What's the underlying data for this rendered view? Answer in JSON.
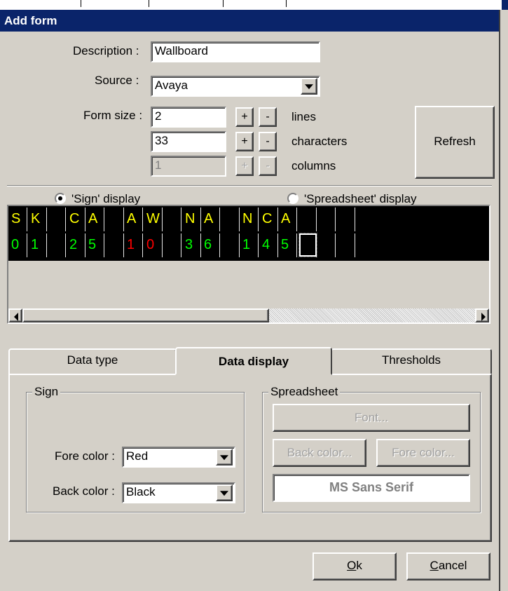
{
  "window": {
    "title": "Add form"
  },
  "form": {
    "description_label": "Description :",
    "description_value": "Wallboard",
    "source_label": "Source :",
    "source_value": "Avaya",
    "formsize_label": "Form size :",
    "lines_value": "2",
    "lines_label": "lines",
    "chars_value": "33",
    "chars_label": "characters",
    "columns_value": "1",
    "columns_label": "columns",
    "plus": "+",
    "minus": "-",
    "refresh": "Refresh"
  },
  "display": {
    "sign_label": "'Sign' display",
    "spreadsheet_label": "'Spreadsheet' display"
  },
  "sign": {
    "row1": [
      {
        "t": "S",
        "c": "#ffff00"
      },
      {
        "t": "K",
        "c": "#ffff00"
      },
      {
        "t": "",
        "c": "#ffff00"
      },
      {
        "t": "C",
        "c": "#ffff00"
      },
      {
        "t": "A",
        "c": "#ffff00"
      },
      {
        "t": "",
        "c": "#ffff00"
      },
      {
        "t": "A",
        "c": "#ffff00"
      },
      {
        "t": "W",
        "c": "#ffff00"
      },
      {
        "t": "",
        "c": "#ffff00"
      },
      {
        "t": "N",
        "c": "#ffff00"
      },
      {
        "t": "A",
        "c": "#ffff00"
      },
      {
        "t": "",
        "c": "#ffff00"
      },
      {
        "t": "N",
        "c": "#ffff00"
      },
      {
        "t": "C",
        "c": "#ffff00"
      },
      {
        "t": "A",
        "c": "#ffff00"
      },
      {
        "t": "",
        "c": "#ffff00"
      },
      {
        "t": "",
        "c": "#ffff00"
      },
      {
        "t": "",
        "c": "#ffff00"
      }
    ],
    "row2": [
      {
        "t": "0",
        "c": "#00ff00"
      },
      {
        "t": "1",
        "c": "#00ff00"
      },
      {
        "t": "",
        "c": "#00ff00"
      },
      {
        "t": "2",
        "c": "#00ff00"
      },
      {
        "t": "5",
        "c": "#00ff00"
      },
      {
        "t": "",
        "c": "#00ff00"
      },
      {
        "t": "1",
        "c": "#ff0000"
      },
      {
        "t": "0",
        "c": "#ff0000"
      },
      {
        "t": "",
        "c": "#00ff00"
      },
      {
        "t": "3",
        "c": "#00ff00"
      },
      {
        "t": "6",
        "c": "#00ff00"
      },
      {
        "t": "",
        "c": "#00ff00"
      },
      {
        "t": "1",
        "c": "#00ff00"
      },
      {
        "t": "4",
        "c": "#00ff00"
      },
      {
        "t": "5",
        "c": "#00ff00"
      },
      {
        "t": "",
        "c": "#00ff00"
      },
      {
        "t": "",
        "c": "#00ff00"
      },
      {
        "t": "",
        "c": "#00ff00"
      }
    ]
  },
  "tabs": {
    "data_type": "Data type",
    "data_display": "Data display",
    "thresholds": "Thresholds"
  },
  "sign_group": {
    "title": "Sign",
    "fore_label": "Fore color :",
    "fore_value": "Red",
    "back_label": "Back color :",
    "back_value": "Black"
  },
  "spreadsheet_group": {
    "title": "Spreadsheet",
    "font_btn": "Font...",
    "back_btn": "Back color...",
    "fore_btn": "Fore color...",
    "font_preview": "MS Sans Serif"
  },
  "buttons": {
    "ok_u": "O",
    "ok_rest": "k",
    "cancel_u": "C",
    "cancel_rest": "ancel"
  },
  "colors": {
    "titlebar": "#0a246a",
    "face": "#d4d0c8",
    "sign_bg": "#000000"
  }
}
